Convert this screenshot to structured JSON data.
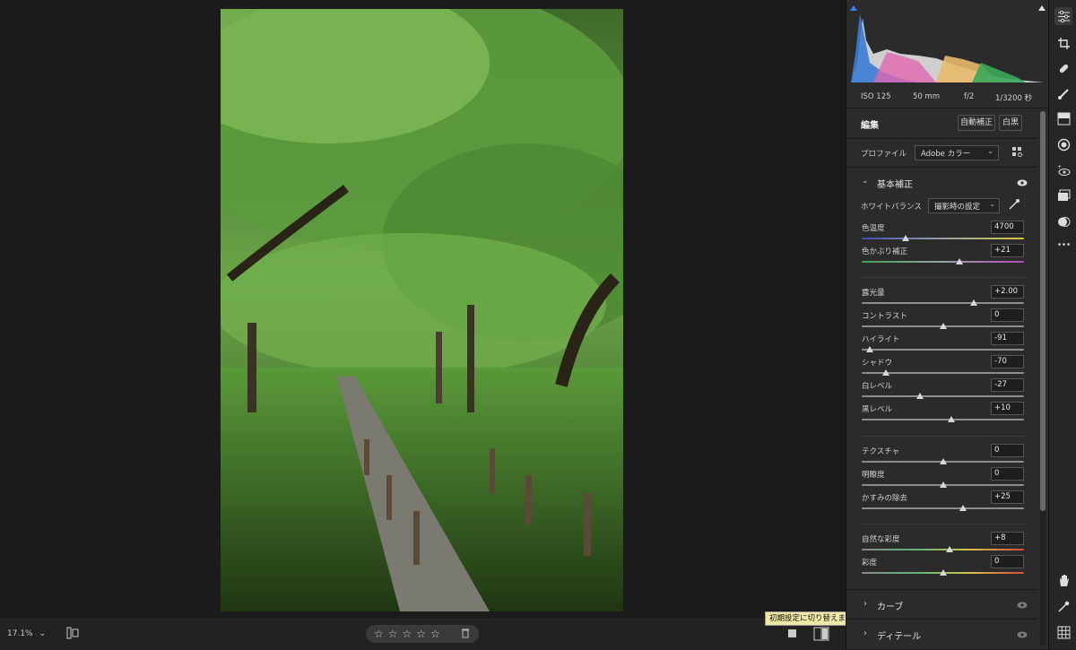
{
  "zoom": "17.1%",
  "histogram": {
    "iso": "ISO 125",
    "focal": "50 mm",
    "aperture": "f/2",
    "shutter": "1/3200 秒"
  },
  "edit": {
    "title": "編集",
    "auto_label": "自動補正",
    "bw_label": "白黒",
    "profile_label": "プロファイル",
    "profile_value": "Adobe カラー"
  },
  "basic": {
    "title": "基本補正",
    "wb_label": "ホワイトバランス",
    "wb_value": "撮影時の設定",
    "sliders": [
      {
        "label": "色温度",
        "value": "4700",
        "pos": 0.27,
        "track": "temp"
      },
      {
        "label": "色かぶり補正",
        "value": "+21",
        "pos": 0.6,
        "track": "tint"
      },
      {
        "label": "露光量",
        "value": "+2.00",
        "pos": 0.69,
        "track": "gray"
      },
      {
        "label": "コントラスト",
        "value": "0",
        "pos": 0.5,
        "track": "gray"
      },
      {
        "label": "ハイライト",
        "value": "-91",
        "pos": 0.05,
        "track": "gray"
      },
      {
        "label": "シャドウ",
        "value": "-70",
        "pos": 0.15,
        "track": "gray"
      },
      {
        "label": "白レベル",
        "value": "-27",
        "pos": 0.36,
        "track": "gray"
      },
      {
        "label": "黒レベル",
        "value": "+10",
        "pos": 0.55,
        "track": "gray"
      },
      {
        "label": "テクスチャ",
        "value": "0",
        "pos": 0.5,
        "track": "gray"
      },
      {
        "label": "明瞭度",
        "value": "0",
        "pos": 0.5,
        "track": "gray"
      },
      {
        "label": "かすみの除去",
        "value": "+25",
        "pos": 0.625,
        "track": "gray"
      },
      {
        "label": "自然な彩度",
        "value": "+8",
        "pos": 0.54,
        "track": "sat"
      },
      {
        "label": "彩度",
        "value": "0",
        "pos": 0.5,
        "track": "sat"
      }
    ]
  },
  "sections": {
    "curve": "カーブ",
    "detail": "ディテール"
  },
  "tooltip": "初期設定に切り替えます (\\)。",
  "rating": {
    "stars": 5
  },
  "tools": [
    "edit-icon",
    "crop-icon",
    "heal-icon",
    "brush-icon",
    "linear-gradient-icon",
    "radial-gradient-icon",
    "redeye-icon",
    "presets-icon",
    "snapshot-icon",
    "more-icon"
  ]
}
